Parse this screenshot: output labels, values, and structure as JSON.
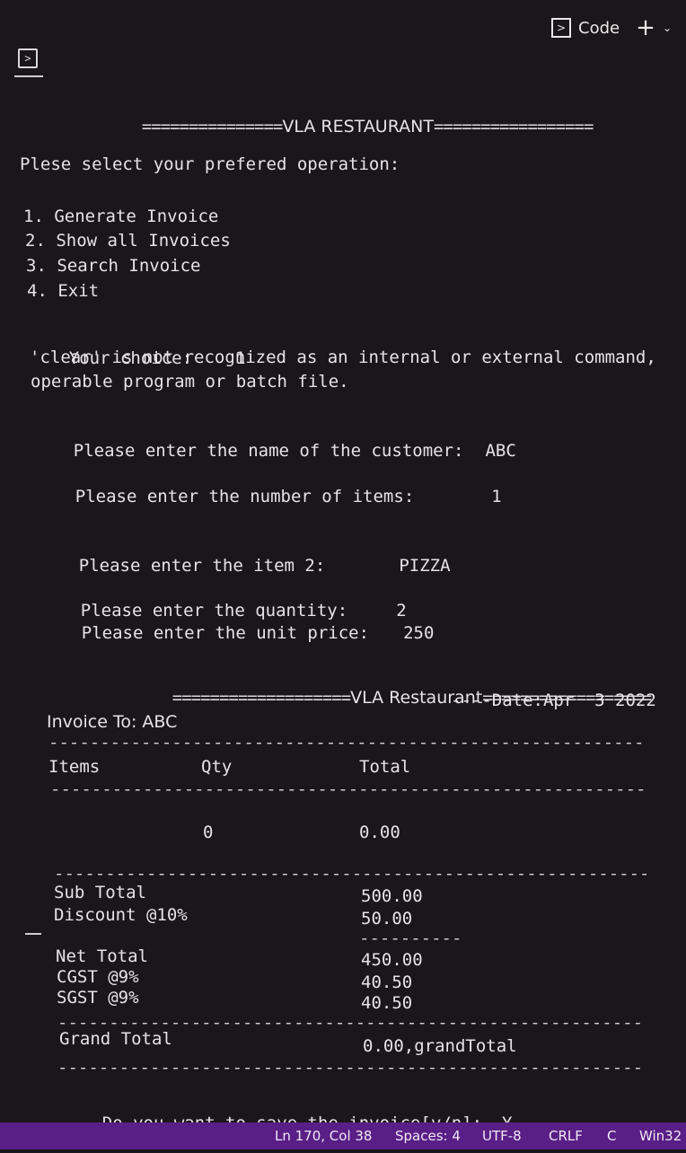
{
  "topbar": {
    "terminal_icon": "terminal-icon",
    "tab_label": "Code",
    "plus_icon": "plus-icon",
    "chevron_icon": "chevron-down-icon"
  },
  "terminal": {
    "banner_left": "===============",
    "banner_title": "VLA RESTAURANT",
    "banner_right": "=================",
    "prompt": "Plese select your prefered operation:",
    "menu": [
      "1. Generate Invoice",
      "2. Show all Invoices",
      "3. Search Invoice",
      "4. Exit"
    ],
    "choice_label": "Your choice:",
    "choice_value": "1",
    "error_line1": "'clear' is not recognized as an internal or external command,",
    "error_line2": "operable program or batch file.",
    "customer_prompt": "Please enter the name of the customer:",
    "customer_value": "ABC",
    "items_prompt": "Please enter the number of items:",
    "items_value": "1",
    "item_prompt": "Please enter the item 2:",
    "item_value": "PIZZA",
    "qty_prompt": "Please enter the quantity:",
    "qty_value": "2",
    "price_prompt": "Please enter the unit price:",
    "price_value": "250",
    "invoice": {
      "header_left": "===================",
      "header_title": "VLA Restaurant",
      "header_right": "==================",
      "date": "----Date:Apr  3 2022",
      "invoice_to": "Invoice To: ABC",
      "col_items": "Items",
      "col_qty": "Qty",
      "col_total": "Total",
      "row_qty": "0",
      "row_total": "0.00",
      "sub_total_label": "Sub Total",
      "sub_total_value": "500.00",
      "discount_label": "Discount @10%",
      "discount_value": "50.00",
      "net_total_label": "Net Total",
      "net_total_value": "450.00",
      "cgst_label": "CGST @9%",
      "cgst_value": "40.50",
      "sgst_label": "SGST @9%",
      "sgst_value": "40.50",
      "grand_total_label": "Grand Total",
      "grand_total_value": "0.00,grandTotal"
    },
    "save_prompt": "Do you want to save the invoice[y/n]:",
    "save_value": "Y"
  },
  "statusbar": {
    "position": "Ln 170, Col 38",
    "spaces": "Spaces: 4",
    "encoding": "UTF-8",
    "eol": "CRLF",
    "language": "C",
    "platform": "Win32"
  }
}
